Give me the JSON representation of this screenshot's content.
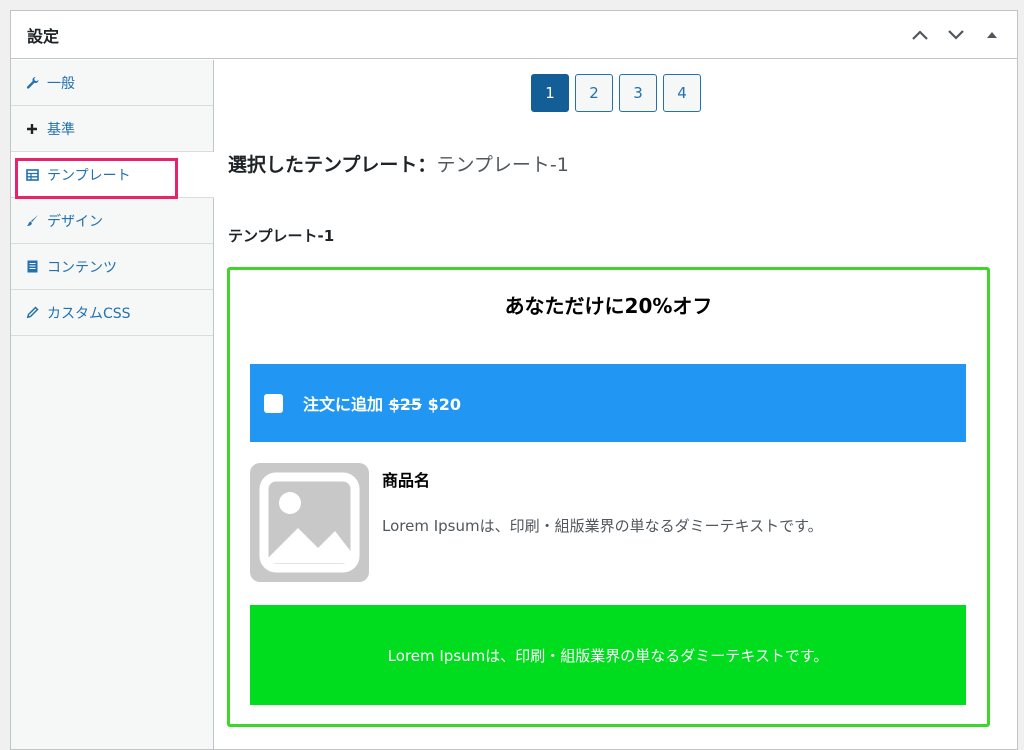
{
  "panel": {
    "title": "設定"
  },
  "sidebar": {
    "items": [
      {
        "label": "一般",
        "icon": "wrench-icon"
      },
      {
        "label": "基準",
        "icon": "plus-icon"
      },
      {
        "label": "テンプレート",
        "icon": "table-icon"
      },
      {
        "label": "デザイン",
        "icon": "brush-icon"
      },
      {
        "label": "コンテンツ",
        "icon": "document-icon"
      },
      {
        "label": "カスタムCSS",
        "icon": "pencil-icon"
      }
    ]
  },
  "pager": {
    "pages": [
      "1",
      "2",
      "3",
      "4"
    ],
    "current": "1"
  },
  "selected": {
    "label": "選択したテンプレート：",
    "value": "テンプレート-1"
  },
  "template": {
    "heading": "テンプレート-1",
    "offer_title": "あなただけに20%オフ",
    "add_label": "注文に追加",
    "old_price": "$25",
    "new_price": "$20",
    "product_name": "商品名",
    "product_desc": "Lorem Ipsumは、印刷・組版業界の単なるダミーテキストです。",
    "cta_text": "Lorem Ipsumは、印刷・組版業界の単なるダミーテキストです。"
  },
  "colors": {
    "link": "#2271b1",
    "pager_active": "#135e96",
    "add_bar": "#2196f3",
    "cta": "#00dc1e",
    "preview_border": "#3dd62a",
    "highlight": "#e8236b"
  }
}
